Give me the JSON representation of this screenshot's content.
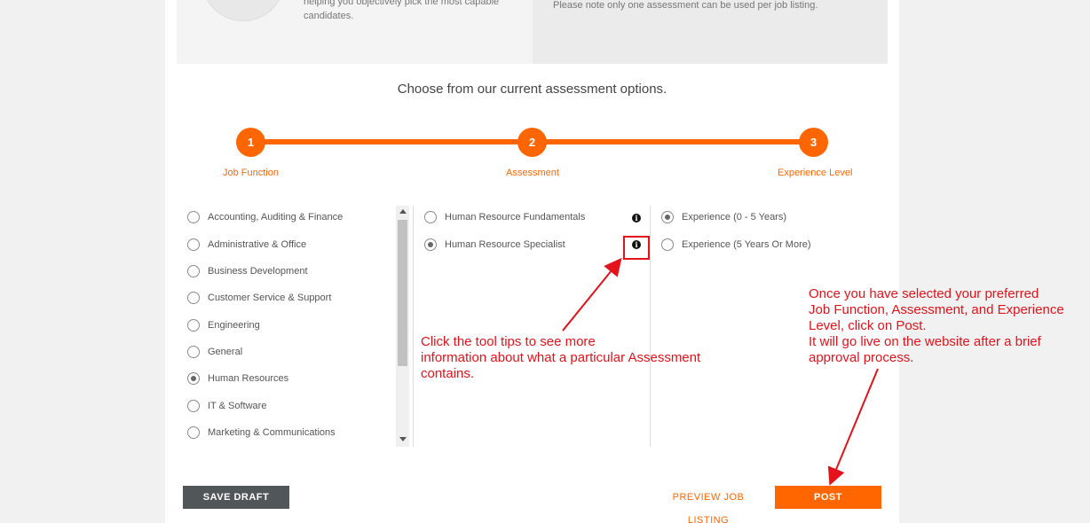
{
  "header": {
    "intro_text": "helping you objectively pick the most capable candidates.",
    "note_text": "Please note only one assessment can be used per job listing."
  },
  "section_title": "Choose from our current assessment options.",
  "steps": [
    {
      "number": "1",
      "label": "Job Function"
    },
    {
      "number": "2",
      "label": "Assessment"
    },
    {
      "number": "3",
      "label": "Experience Level"
    }
  ],
  "job_functions": [
    {
      "label": "Accounting, Auditing & Finance",
      "checked": false
    },
    {
      "label": "Administrative & Office",
      "checked": false
    },
    {
      "label": "Business Development",
      "checked": false
    },
    {
      "label": "Customer Service & Support",
      "checked": false
    },
    {
      "label": "Engineering",
      "checked": false
    },
    {
      "label": "General",
      "checked": false
    },
    {
      "label": "Human Resources",
      "checked": true
    },
    {
      "label": "IT & Software",
      "checked": false
    },
    {
      "label": "Marketing & Communications",
      "checked": false
    }
  ],
  "assessments": [
    {
      "label": "Human Resource Fundamentals",
      "checked": false,
      "info_icon": "i"
    },
    {
      "label": "Human Resource Specialist",
      "checked": true,
      "info_icon": "i"
    }
  ],
  "experience_levels": [
    {
      "label": "Experience (0 - 5 Years)",
      "checked": true
    },
    {
      "label": "Experience (5 Years Or More)",
      "checked": false
    }
  ],
  "annotations": {
    "tooltip_note": [
      "Click the tool tips to see more",
      "information about what a particular Assessment",
      "contains."
    ],
    "post_note": [
      "Once you have selected your preferred",
      "Job Function, Assessment, and Experience",
      "Level, click on Post.",
      "It will go live on the website after a brief",
      "approval process."
    ]
  },
  "buttons": {
    "save_draft": "SAVE DRAFT",
    "preview": "PREVIEW JOB LISTING",
    "post": "POST"
  },
  "colors": {
    "accent": "#ff6600",
    "annotation": "#e3121b",
    "save_button": "#515659"
  }
}
